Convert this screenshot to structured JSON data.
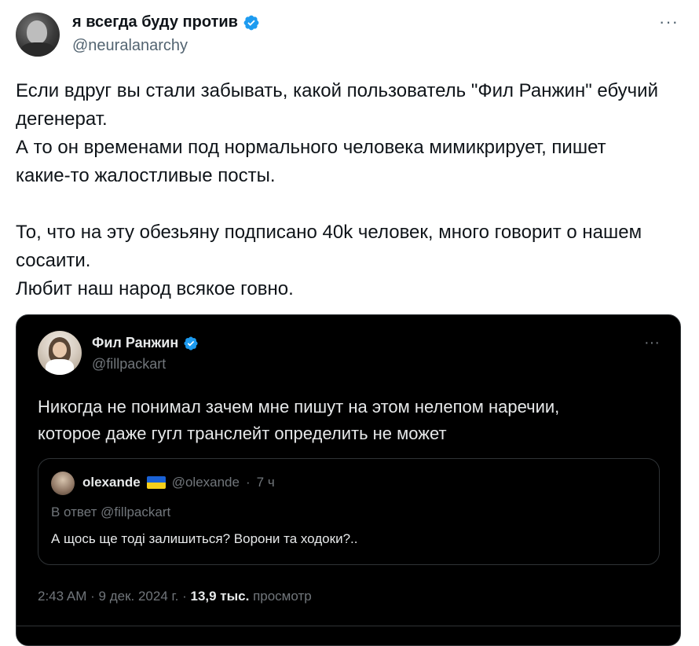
{
  "outer_tweet": {
    "display_name": "я всегда буду против",
    "handle": "@neuralanarchy",
    "more_label": "···",
    "text_lines": [
      "Если вдруг вы стали забывать, какой пользователь \"Фил Ранжин\" ебучий",
      "дегенерат.",
      "А то он временами под нормального человека мимикрирует, пишет",
      "какие-то жалостливые посты.",
      "То, что на эту обезьяну подписано 40k человек, много говорит о нашем",
      "сосаити.",
      "Любит наш народ всякое говно."
    ]
  },
  "embedded_tweet": {
    "display_name": "Фил Ранжин",
    "handle": "@fillpackart",
    "more_label": "···",
    "text_lines": [
      "Никогда не понимал зачем мне пишут на этом нелепом наречии,",
      "которое даже гугл транслейт определить не может"
    ],
    "quote": {
      "display_name": "olexande",
      "handle": "@olexande",
      "separator": "·",
      "time": "7 ч",
      "replying_to": "В ответ @fillpackart",
      "text": "А щось ще тоді залишиться? Ворони та ходоки?.."
    },
    "meta": {
      "time": "2:43 AM",
      "separator": "·",
      "date": "9 дек. 2024 г.",
      "views_count": "13,9 тыс.",
      "views_label": "просмотр"
    }
  },
  "colors": {
    "verified_blue": "#1d9bf0",
    "dark_bg": "#000000",
    "muted_text": "#536471",
    "dark_muted_text": "#71767b"
  }
}
